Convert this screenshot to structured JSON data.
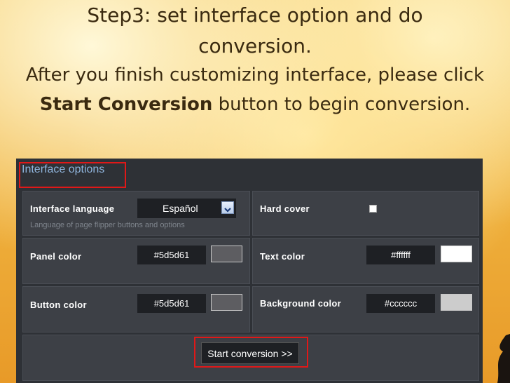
{
  "slide": {
    "title_line1": "Step3: set interface option and do",
    "title_line2": "conversion.",
    "body_prefix": "After you finish customizing interface, please click ",
    "body_bold": "Start Conversion",
    "body_suffix": " button to begin conversion."
  },
  "panel": {
    "header": "Interface options",
    "interface_language": {
      "label": "Interface language",
      "value": "Español",
      "hint": "Language of page flipper buttons and options"
    },
    "hard_cover": {
      "label": "Hard cover",
      "checked": false
    },
    "panel_color": {
      "label": "Panel color",
      "value": "#5d5d61",
      "swatch": "#5d5d61"
    },
    "text_color": {
      "label": "Text color",
      "value": "#ffffff",
      "swatch": "#ffffff"
    },
    "button_color": {
      "label": "Button color",
      "value": "#5d5d61",
      "swatch": "#5d5d61"
    },
    "background_color": {
      "label": "Background color",
      "value": "#cccccc",
      "swatch": "#cccccc"
    },
    "start_button": "Start conversion >>"
  },
  "colors": {
    "highlight": "#e01818",
    "panel_bg": "#2e3136",
    "cell_bg": "#3d4046",
    "header_text": "#8fb4dc"
  }
}
